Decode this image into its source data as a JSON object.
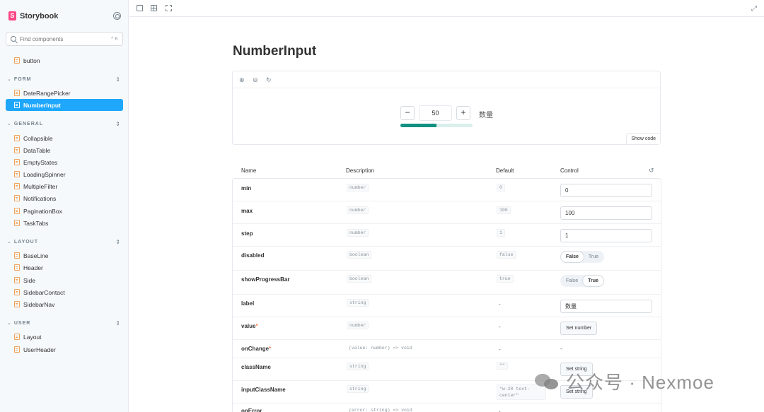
{
  "sidebar": {
    "brand": "Storybook",
    "search_placeholder": "Find components",
    "search_shortcut": "^ K",
    "top_items": [
      {
        "label": "button"
      }
    ],
    "groups": [
      {
        "label": "FORM",
        "items": [
          "DateRangePicker",
          "NumberInput"
        ]
      },
      {
        "label": "GENERAL",
        "items": [
          "Collapsible",
          "DataTable",
          "EmptyStates",
          "LoadingSpinner",
          "MultipleFilter",
          "Notifications",
          "PaginationBox",
          "TaskTabs"
        ]
      },
      {
        "label": "LAYOUT",
        "items": [
          "BaseLine",
          "Header",
          "Side",
          "SidebarContact",
          "SidebarNav"
        ]
      },
      {
        "label": "USER",
        "items": [
          "Layout",
          "UserHeader"
        ]
      }
    ],
    "active_item": "NumberInput"
  },
  "main": {
    "title": "NumberInput",
    "preview": {
      "minus": "−",
      "plus": "+",
      "value": "50",
      "label": "数量",
      "progress": 0.5,
      "show_code": "Show code"
    },
    "table": {
      "headers": {
        "name": "Name",
        "description": "Description",
        "default": "Default",
        "control": "Control"
      },
      "rows": [
        {
          "name": "min",
          "type": "number",
          "default": "0",
          "control_value": "0"
        },
        {
          "name": "max",
          "type": "number",
          "default": "100",
          "control_value": "100"
        },
        {
          "name": "step",
          "type": "number",
          "default": "1",
          "control_value": "1"
        },
        {
          "name": "disabled",
          "type": "boolean",
          "default": "false",
          "toggle": [
            "False",
            "True"
          ],
          "toggle_on": "False"
        },
        {
          "name": "showProgressBar",
          "type": "boolean",
          "default": "true",
          "toggle": [
            "False",
            "True"
          ],
          "toggle_on": "True"
        },
        {
          "name": "label",
          "type": "string",
          "default": "-",
          "control_value": "数量"
        },
        {
          "name": "value",
          "required": "*",
          "type": "number",
          "default": "-",
          "button": "Set number"
        },
        {
          "name": "onChange",
          "required": "*",
          "type": "(value: number) => void",
          "default": "-",
          "control_text": "-"
        },
        {
          "name": "className",
          "type": "string",
          "default": "\"\"",
          "button": "Set string"
        },
        {
          "name": "inputClassName",
          "type": "string",
          "default": "\"w-20 text-center\"",
          "button": "Set string"
        },
        {
          "name": "onError",
          "type": "(error: string) => void",
          "default": "-",
          "control_text": "-"
        }
      ]
    }
  },
  "watermark": {
    "text": "公众号 · Nexmoe"
  },
  "colors": {
    "accent": "#1ea7fd",
    "progress": "#119182",
    "brand": "#ff4785"
  }
}
